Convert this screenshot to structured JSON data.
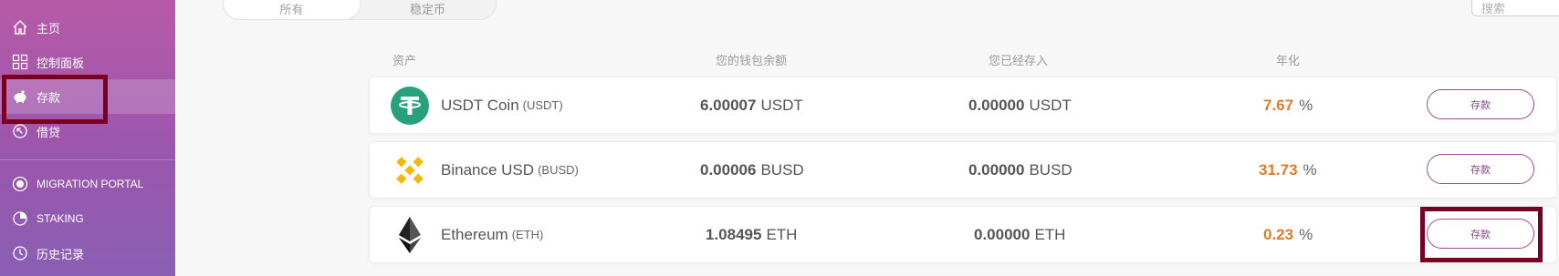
{
  "sidebar": {
    "items": [
      {
        "label": "主页",
        "icon": "home-icon"
      },
      {
        "label": "控制面板",
        "icon": "dashboard-icon"
      },
      {
        "label": "存款",
        "icon": "piggy-bank-icon"
      },
      {
        "label": "借贷",
        "icon": "borrow-icon"
      },
      {
        "label": "MIGRATION PORTAL",
        "icon": "migration-icon"
      },
      {
        "label": "STAKING",
        "icon": "pie-chart-icon"
      },
      {
        "label": "历史记录",
        "icon": "history-icon"
      }
    ],
    "active_index": 2
  },
  "tabs": [
    {
      "label": "所有"
    },
    {
      "label": "稳定币"
    }
  ],
  "search": {
    "placeholder": "搜索"
  },
  "table": {
    "headers": {
      "asset": "资产",
      "wallet_balance": "您的钱包余额",
      "deposited": "您已经存入",
      "apy": "年化"
    },
    "rows": [
      {
        "name": "USDT Coin",
        "symbol": "(USDT)",
        "wallet_amount": "6.00007",
        "wallet_unit": "USDT",
        "deposited_amount": "0.00000",
        "deposited_unit": "USDT",
        "apy": "7.67",
        "apy_unit": "%",
        "button": "存款",
        "icon": "tether-icon"
      },
      {
        "name": "Binance USD",
        "symbol": "(BUSD)",
        "wallet_amount": "0.00006",
        "wallet_unit": "BUSD",
        "deposited_amount": "0.00000",
        "deposited_unit": "BUSD",
        "apy": "31.73",
        "apy_unit": "%",
        "button": "存款",
        "icon": "binance-icon"
      },
      {
        "name": "Ethereum",
        "symbol": "(ETH)",
        "wallet_amount": "1.08495",
        "wallet_unit": "ETH",
        "deposited_amount": "0.00000",
        "deposited_unit": "ETH",
        "apy": "0.23",
        "apy_unit": "%",
        "button": "存款",
        "icon": "ethereum-icon"
      }
    ]
  },
  "colors": {
    "sidebar_top": "#b65aa7",
    "sidebar_bottom": "#8a5fb4",
    "apy_orange": "#e07b2c",
    "button_purple": "#a04a95",
    "highlight_box": "#7a0021"
  }
}
